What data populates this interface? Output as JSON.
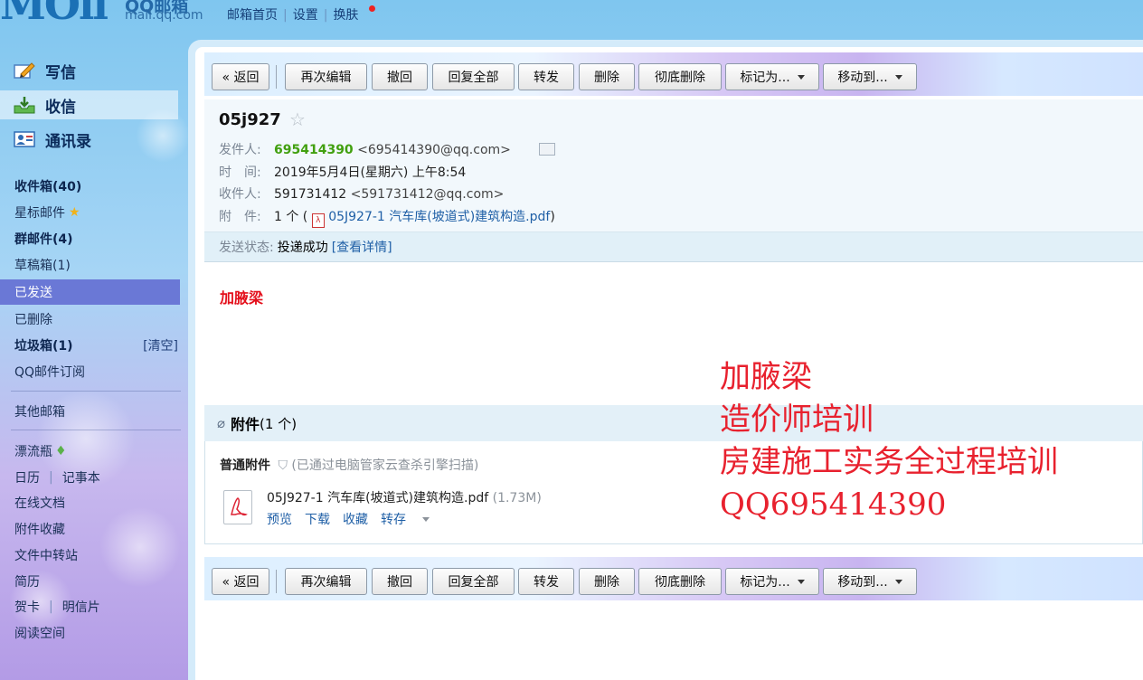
{
  "header": {
    "logo_text": "MOil",
    "logo_cn": "QQ邮箱",
    "logo_domain": "mail.qq.com",
    "links": [
      "邮箱首页",
      "设置",
      "换肤"
    ]
  },
  "sidebar": {
    "primary": [
      {
        "label": "写信"
      },
      {
        "label": "收信"
      },
      {
        "label": "通讯录"
      }
    ],
    "folders": {
      "inbox": "收件箱(40)",
      "starred": "星标邮件",
      "group": "群邮件(4)",
      "drafts": "草稿箱(1)",
      "sent": "已发送",
      "deleted": "已删除",
      "spam": "垃圾箱(1)",
      "spam_clear": "[清空]",
      "subscribe": "QQ邮件订阅",
      "other": "其他邮箱",
      "drift": "漂流瓶",
      "calendar": "日历",
      "notes": "记事本",
      "docs": "在线文档",
      "att_collection": "附件收藏",
      "transfer": "文件中转站",
      "resume": "简历",
      "cards": "贺卡",
      "postcards": "明信片",
      "reading": "阅读空间"
    }
  },
  "toolbar": {
    "back": "« 返回",
    "reedit": "再次编辑",
    "recall": "撤回",
    "reply_all": "回复全部",
    "forward": "转发",
    "delete": "删除",
    "delete_perm": "彻底删除",
    "mark_as": "标记为...",
    "move_to": "移动到..."
  },
  "mail": {
    "subject": "05j927",
    "from_label": "发件人:",
    "from_name": "695414390",
    "from_addr": "<695414390@qq.com>",
    "time_label": "时　间:",
    "time": "2019年5月4日(星期六) 上午8:54",
    "to_label": "收件人:",
    "to_name": "591731412",
    "to_addr": "<591731412@qq.com>",
    "att_label": "附　件:",
    "att_count": "1 个 (",
    "att_name": "05J927-1 汽车库(坡道式)建筑构造.pdf",
    "att_close": ")",
    "status_label": "发送状态:",
    "status": "投递成功",
    "status_link": "[查看详情]",
    "body": "加腋梁"
  },
  "attachments": {
    "title": "附件",
    "count": "(1 个)",
    "normal_label": "普通附件",
    "scan": "(已通过电脑管家云查杀引擎扫描)",
    "file_name": "05J927-1 汽车库(坡道式)建筑构造.pdf",
    "file_size": "(1.73M)",
    "actions": [
      "预览",
      "下载",
      "收藏",
      "转存"
    ]
  },
  "overlay": [
    "加腋梁",
    "造价师培训",
    "房建施工实务全过程培训",
    "QQ695414390"
  ]
}
